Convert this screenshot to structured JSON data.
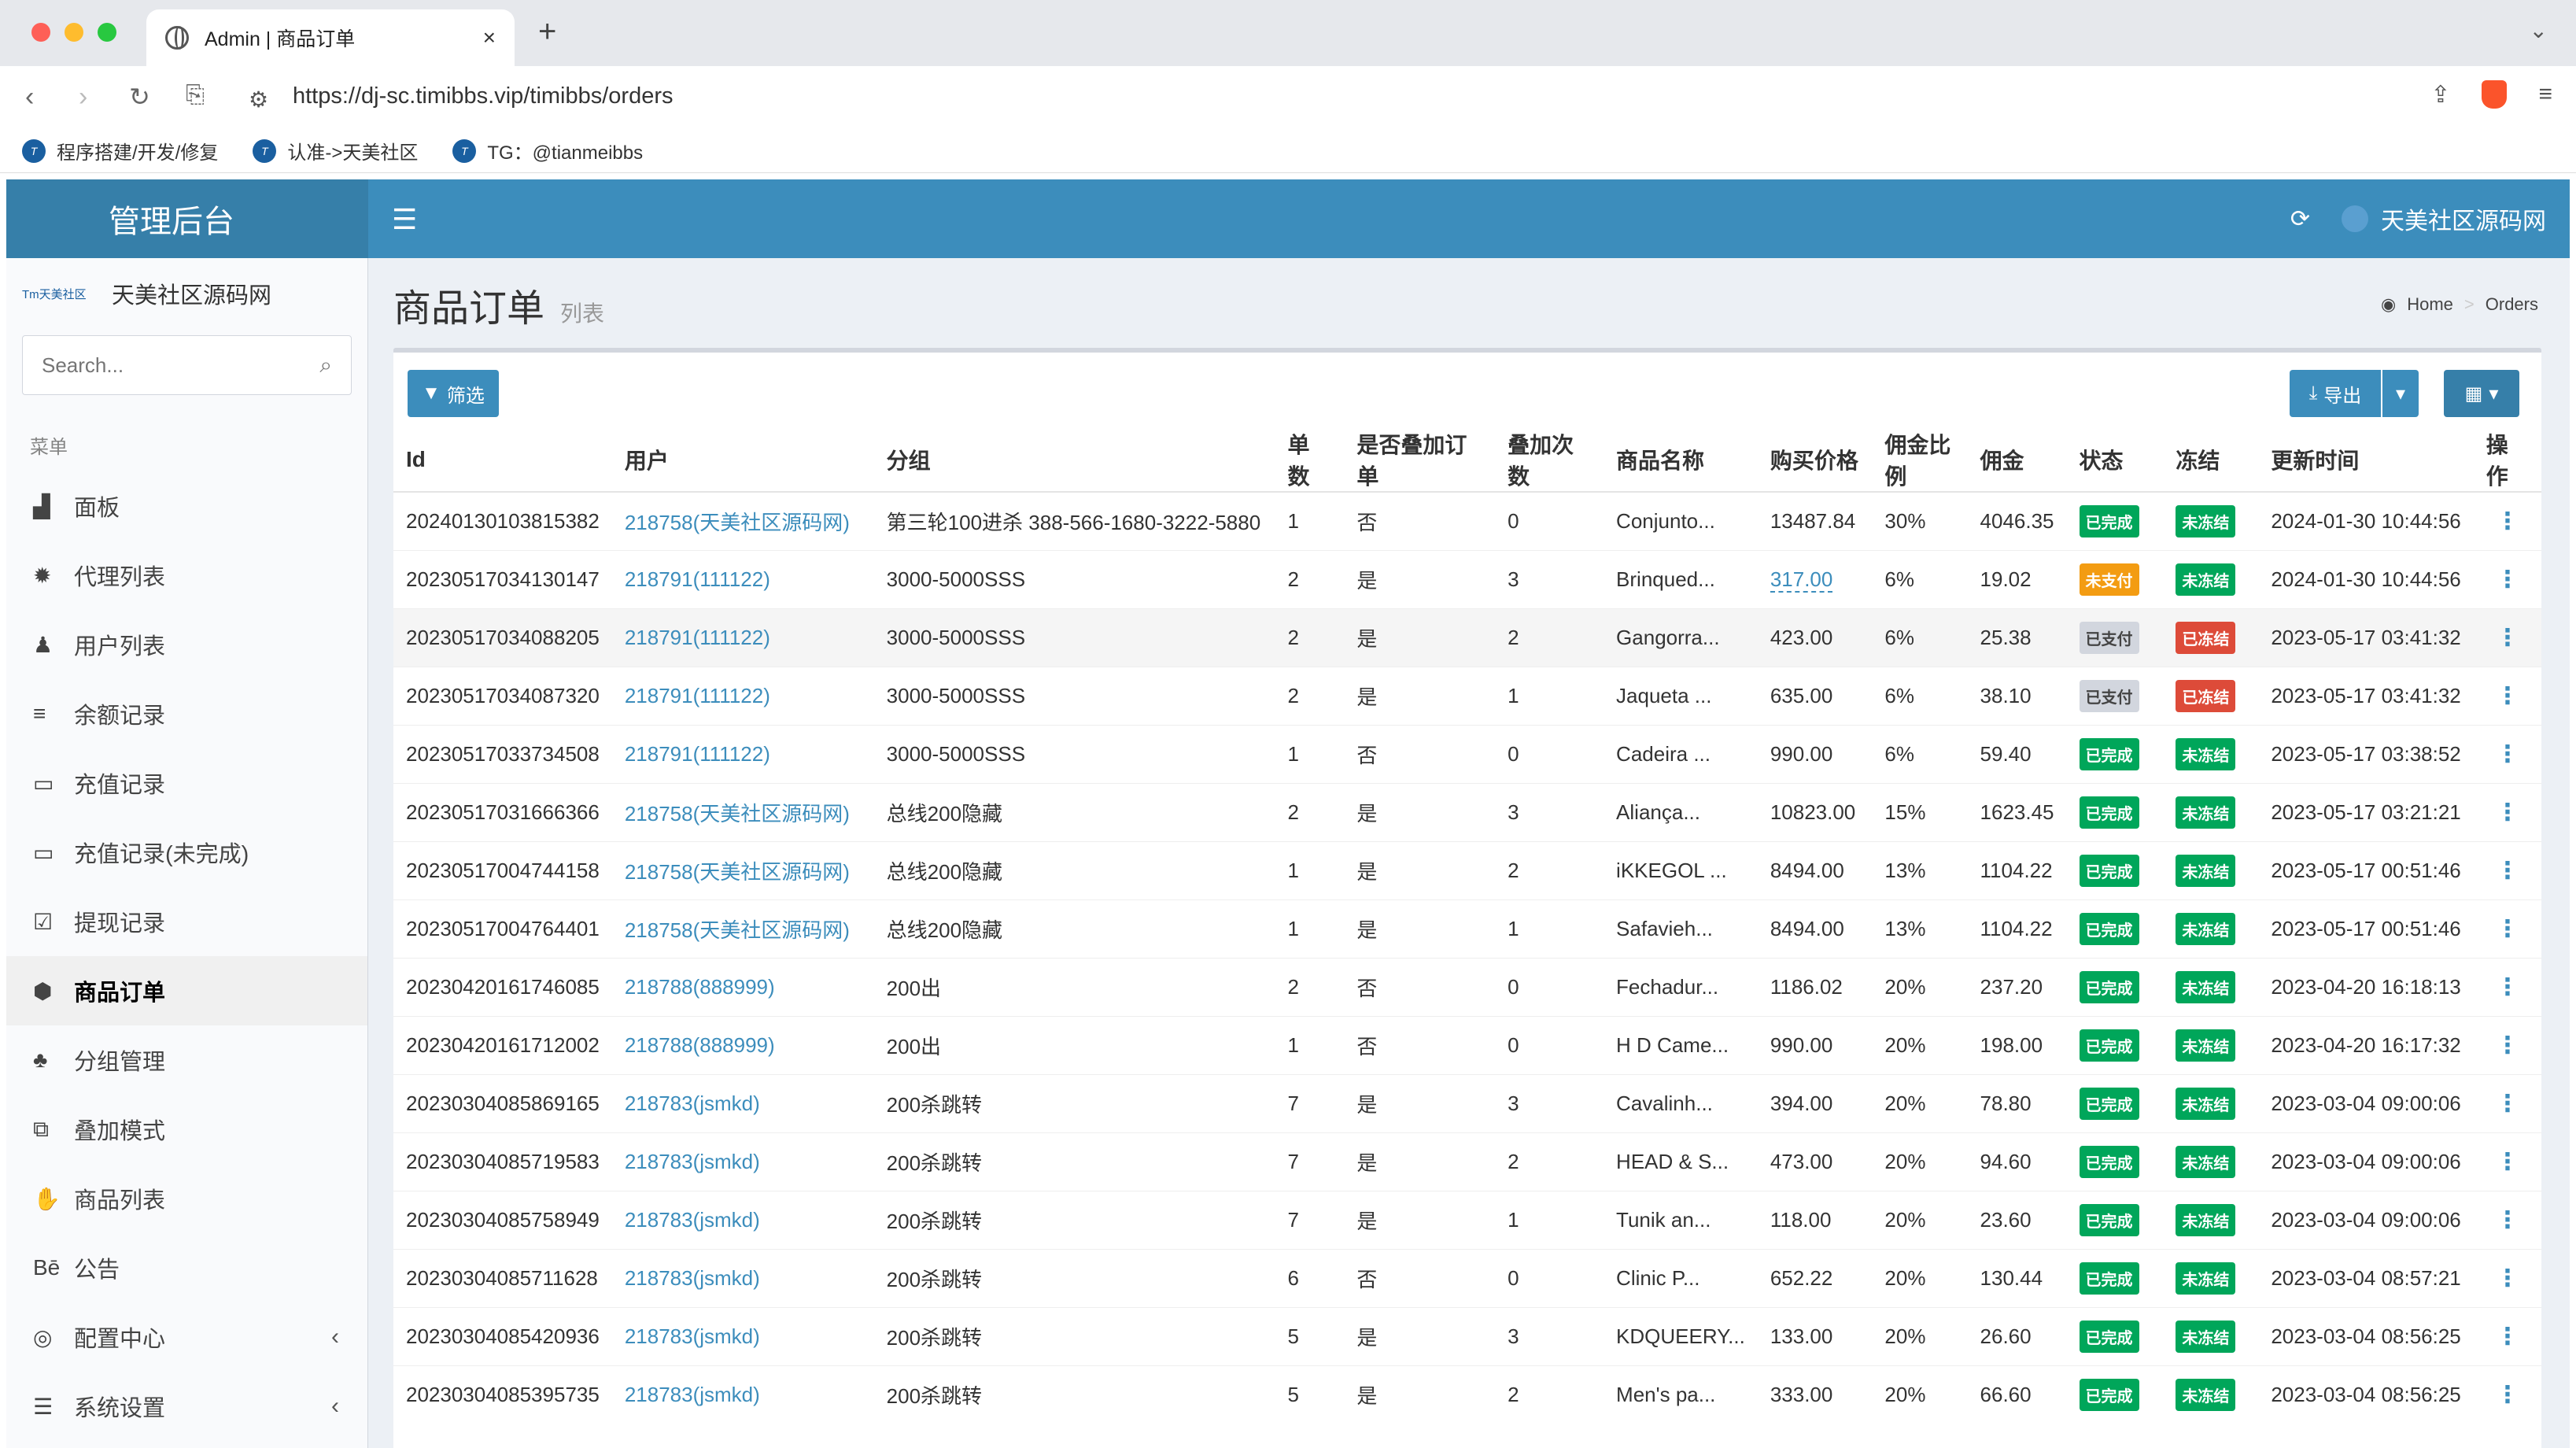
{
  "browser": {
    "tab_title": "Admin | 商品订单",
    "tab_close": "×",
    "new_tab": "+",
    "tab_menu": "⌄",
    "url_host": "https://dj-sc.timibbs.vip",
    "url_path": "/timibbs/orders",
    "bookmarks": [
      "程序搭建/开发/修复",
      "认准->天美社区",
      "TG：@tianmeibbs"
    ],
    "colors": {
      "red": "#fe5f57",
      "yellow": "#febc2e",
      "green": "#28c840"
    }
  },
  "app": {
    "logo": "管理后台",
    "site_name": "天美社区源码网",
    "user_name": "天美社区源码网",
    "search_placeholder": "Search...",
    "menu_header": "菜单",
    "menu": [
      {
        "label": "面板",
        "icon": "area-chart-icon",
        "glyph": "▟"
      },
      {
        "label": "代理列表",
        "icon": "gear-icon",
        "glyph": "✹"
      },
      {
        "label": "用户列表",
        "icon": "user-icon",
        "glyph": "♟"
      },
      {
        "label": "余额记录",
        "icon": "list-icon",
        "glyph": "≡"
      },
      {
        "label": "充值记录",
        "icon": "battery-icon",
        "glyph": "▭"
      },
      {
        "label": "充值记录(未完成)",
        "icon": "battery-empty-icon",
        "glyph": "▭"
      },
      {
        "label": "提现记录",
        "icon": "check-square-icon",
        "glyph": "☑"
      },
      {
        "label": "商品订单",
        "icon": "cube-icon",
        "glyph": "⬢"
      },
      {
        "label": "分组管理",
        "icon": "users-icon",
        "glyph": "♣"
      },
      {
        "label": "叠加模式",
        "icon": "object-group-icon",
        "glyph": "⧉"
      },
      {
        "label": "商品列表",
        "icon": "hand-icon",
        "glyph": "✋"
      },
      {
        "label": "公告",
        "icon": "behance-icon",
        "glyph": "Bē"
      },
      {
        "label": "配置中心",
        "icon": "chrome-icon",
        "glyph": "◎",
        "arrow": "‹"
      },
      {
        "label": "系统设置",
        "icon": "server-icon",
        "glyph": "☰",
        "arrow": "‹"
      }
    ],
    "active_menu": 7
  },
  "page": {
    "title": "商品订单",
    "subtitle": "列表",
    "breadcrumb": [
      "Home",
      "Orders"
    ],
    "filter_button": "筛选",
    "export_button": "导出",
    "columns": [
      "Id",
      "用户",
      "分组",
      "单数",
      "是否叠加订单",
      "叠加次数",
      "商品名称",
      "购买价格",
      "佣金比例",
      "佣金",
      "状态",
      "冻结",
      "更新时间",
      "操作"
    ],
    "rows": [
      [
        "20240130103815382",
        "218758(天美社区源码网)",
        "第三轮100进杀 388-566-1680-3222-5880",
        "1",
        "否",
        "0",
        "Conjunto...",
        "13487.84",
        "30%",
        "4046.35",
        "已完成",
        "未冻结",
        "2024-01-30 10:44:56"
      ],
      [
        "20230517034130147",
        "218791(111122)",
        "3000-5000SSS",
        "2",
        "是",
        "3",
        "Brinqued...",
        "317.00",
        "6%",
        "19.02",
        "未支付",
        "未冻结",
        "2024-01-30 10:44:56"
      ],
      [
        "20230517034088205",
        "218791(111122)",
        "3000-5000SSS",
        "2",
        "是",
        "2",
        "Gangorra...",
        "423.00",
        "6%",
        "25.38",
        "已支付",
        "已冻结",
        "2023-05-17 03:41:32"
      ],
      [
        "20230517034087320",
        "218791(111122)",
        "3000-5000SSS",
        "2",
        "是",
        "1",
        "Jaqueta ...",
        "635.00",
        "6%",
        "38.10",
        "已支付",
        "已冻结",
        "2023-05-17 03:41:32"
      ],
      [
        "20230517033734508",
        "218791(111122)",
        "3000-5000SSS",
        "1",
        "否",
        "0",
        "Cadeira ...",
        "990.00",
        "6%",
        "59.40",
        "已完成",
        "未冻结",
        "2023-05-17 03:38:52"
      ],
      [
        "20230517031666366",
        "218758(天美社区源码网)",
        "总线200隐藏",
        "2",
        "是",
        "3",
        "Aliança...",
        "10823.00",
        "15%",
        "1623.45",
        "已完成",
        "未冻结",
        "2023-05-17 03:21:21"
      ],
      [
        "20230517004744158",
        "218758(天美社区源码网)",
        "总线200隐藏",
        "1",
        "是",
        "2",
        "iKKEGOL ...",
        "8494.00",
        "13%",
        "1104.22",
        "已完成",
        "未冻结",
        "2023-05-17 00:51:46"
      ],
      [
        "20230517004764401",
        "218758(天美社区源码网)",
        "总线200隐藏",
        "1",
        "是",
        "1",
        "Safavieh...",
        "8494.00",
        "13%",
        "1104.22",
        "已完成",
        "未冻结",
        "2023-05-17 00:51:46"
      ],
      [
        "20230420161746085",
        "218788(888999)",
        "200出",
        "2",
        "否",
        "0",
        "Fechadur...",
        "1186.02",
        "20%",
        "237.20",
        "已完成",
        "未冻结",
        "2023-04-20 16:18:13"
      ],
      [
        "20230420161712002",
        "218788(888999)",
        "200出",
        "1",
        "否",
        "0",
        "H D Came...",
        "990.00",
        "20%",
        "198.00",
        "已完成",
        "未冻结",
        "2023-04-20 16:17:32"
      ],
      [
        "20230304085869165",
        "218783(jsmkd)",
        "200杀跳转",
        "7",
        "是",
        "3",
        "Cavalinh...",
        "394.00",
        "20%",
        "78.80",
        "已完成",
        "未冻结",
        "2023-03-04 09:00:06"
      ],
      [
        "20230304085719583",
        "218783(jsmkd)",
        "200杀跳转",
        "7",
        "是",
        "2",
        "HEAD & S...",
        "473.00",
        "20%",
        "94.60",
        "已完成",
        "未冻结",
        "2023-03-04 09:00:06"
      ],
      [
        "20230304085758949",
        "218783(jsmkd)",
        "200杀跳转",
        "7",
        "是",
        "1",
        "Tunik an...",
        "118.00",
        "20%",
        "23.60",
        "已完成",
        "未冻结",
        "2023-03-04 09:00:06"
      ],
      [
        "20230304085711628",
        "218783(jsmkd)",
        "200杀跳转",
        "6",
        "否",
        "0",
        "Clinic P...",
        "652.22",
        "20%",
        "130.44",
        "已完成",
        "未冻结",
        "2023-03-04 08:57:21"
      ],
      [
        "20230304085420936",
        "218783(jsmkd)",
        "200杀跳转",
        "5",
        "是",
        "3",
        "KDQUEERY...",
        "133.00",
        "20%",
        "26.60",
        "已完成",
        "未冻结",
        "2023-03-04 08:56:25"
      ],
      [
        "20230304085395735",
        "218783(jsmkd)",
        "200杀跳转",
        "5",
        "是",
        "2",
        "Men's pa...",
        "333.00",
        "20%",
        "66.60",
        "已完成",
        "未冻结",
        "2023-03-04 08:56:25"
      ]
    ],
    "highlight_row": 2,
    "status_colors": {
      "已完成": "ok",
      "未支付": "warn",
      "已支付": "gray",
      "未冻结": "ok",
      "已冻结": "red"
    }
  }
}
